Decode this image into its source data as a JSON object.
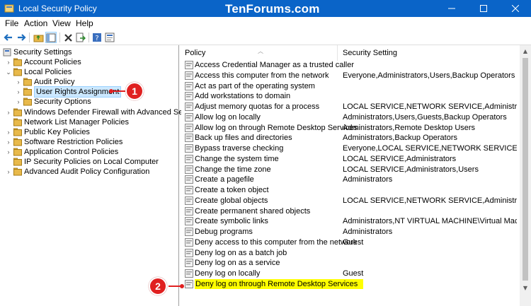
{
  "window": {
    "title": "Local Security Policy",
    "watermark": "TenForums.com",
    "minimize": "—",
    "maximize": "☐",
    "close": "✕"
  },
  "menu": [
    "File",
    "Action",
    "View",
    "Help"
  ],
  "toolbar_icons": [
    "back-icon",
    "forward-icon",
    "up-folder-icon",
    "show-hide-tree-icon",
    "delete-icon",
    "export-list-icon",
    "help-icon",
    "properties-icon"
  ],
  "tree": {
    "root": "Security Settings",
    "items": [
      {
        "label": "Account Policies",
        "level": 1,
        "expander": "collapsed"
      },
      {
        "label": "Local Policies",
        "level": 1,
        "expander": "expanded"
      },
      {
        "label": "Audit Policy",
        "level": 2,
        "expander": "collapsed"
      },
      {
        "label": "User Rights Assignment",
        "level": 2,
        "expander": "collapsed",
        "selected": true
      },
      {
        "label": "Security Options",
        "level": 2,
        "expander": "collapsed"
      },
      {
        "label": "Windows Defender Firewall with Advanced Security",
        "level": 1,
        "expander": "collapsed"
      },
      {
        "label": "Network List Manager Policies",
        "level": 1,
        "expander": "none"
      },
      {
        "label": "Public Key Policies",
        "level": 1,
        "expander": "collapsed"
      },
      {
        "label": "Software Restriction Policies",
        "level": 1,
        "expander": "collapsed"
      },
      {
        "label": "Application Control Policies",
        "level": 1,
        "expander": "collapsed"
      },
      {
        "label": "IP Security Policies on Local Computer",
        "level": 1,
        "expander": "none"
      },
      {
        "label": "Advanced Audit Policy Configuration",
        "level": 1,
        "expander": "collapsed"
      }
    ]
  },
  "columns": {
    "policy": "Policy",
    "setting": "Security Setting"
  },
  "policies": [
    {
      "name": "Access Credential Manager as a trusted caller",
      "setting": ""
    },
    {
      "name": "Access this computer from the network",
      "setting": "Everyone,Administrators,Users,Backup Operators"
    },
    {
      "name": "Act as part of the operating system",
      "setting": ""
    },
    {
      "name": "Add workstations to domain",
      "setting": ""
    },
    {
      "name": "Adjust memory quotas for a process",
      "setting": "LOCAL SERVICE,NETWORK SERVICE,Administrators"
    },
    {
      "name": "Allow log on locally",
      "setting": "Administrators,Users,Guests,Backup Operators"
    },
    {
      "name": "Allow log on through Remote Desktop Services",
      "setting": "Administrators,Remote Desktop Users"
    },
    {
      "name": "Back up files and directories",
      "setting": "Administrators,Backup Operators"
    },
    {
      "name": "Bypass traverse checking",
      "setting": "Everyone,LOCAL SERVICE,NETWORK SERVICE,Administrat..."
    },
    {
      "name": "Change the system time",
      "setting": "LOCAL SERVICE,Administrators"
    },
    {
      "name": "Change the time zone",
      "setting": "LOCAL SERVICE,Administrators,Users"
    },
    {
      "name": "Create a pagefile",
      "setting": "Administrators"
    },
    {
      "name": "Create a token object",
      "setting": ""
    },
    {
      "name": "Create global objects",
      "setting": "LOCAL SERVICE,NETWORK SERVICE,Administrators,SERVICE"
    },
    {
      "name": "Create permanent shared objects",
      "setting": ""
    },
    {
      "name": "Create symbolic links",
      "setting": "Administrators,NT VIRTUAL MACHINE\\Virtual Machines"
    },
    {
      "name": "Debug programs",
      "setting": "Administrators"
    },
    {
      "name": "Deny access to this computer from the network",
      "setting": "Guest"
    },
    {
      "name": "Deny log on as a batch job",
      "setting": ""
    },
    {
      "name": "Deny log on as a service",
      "setting": ""
    },
    {
      "name": "Deny log on locally",
      "setting": "Guest"
    },
    {
      "name": "Deny log on through Remote Desktop Services",
      "setting": "",
      "highlighted": true
    }
  ],
  "callouts": [
    "1",
    "2"
  ],
  "colors": {
    "titlebar": "#0a64c8",
    "selection": "#cce8ff",
    "highlight": "#ffff00",
    "callout": "#e02020",
    "folder": "#e8b94a"
  }
}
